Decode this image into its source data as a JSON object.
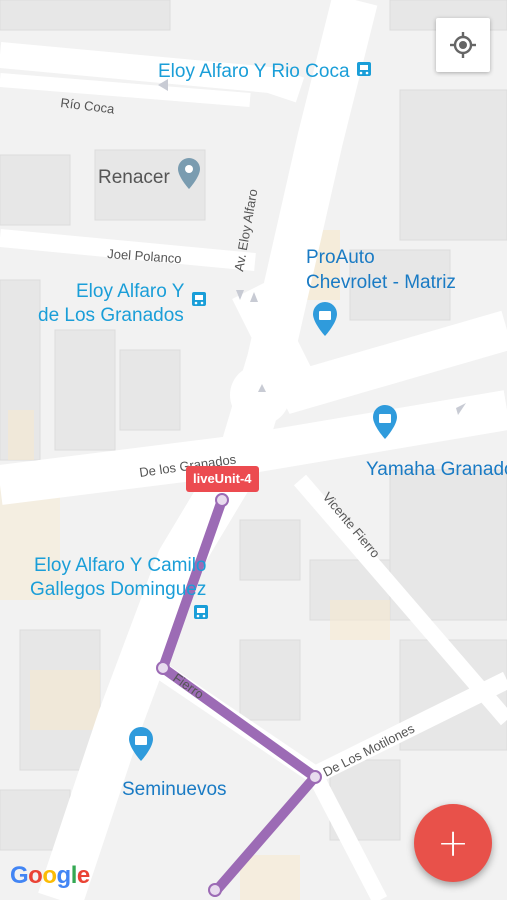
{
  "map": {
    "stops": [
      {
        "name": "Eloy Alfaro Y Rio Coca"
      },
      {
        "name_line1": "Eloy Alfaro Y",
        "name_line2": "de Los Granados"
      },
      {
        "name_line1": "Eloy Alfaro Y Camilo",
        "name_line2": "Gallegos Dominguez"
      }
    ],
    "places": [
      {
        "name": "Renacer"
      },
      {
        "name_line1": "ProAuto",
        "name_line2": "Chevrolet - Matriz"
      },
      {
        "name": "Yamaha Granados"
      },
      {
        "name": "Seminuevos"
      }
    ],
    "streets": [
      {
        "name": "Río Coca"
      },
      {
        "name": "Joel Polanco"
      },
      {
        "name": "Av. Eloy Alfaro"
      },
      {
        "name": "De los Granados"
      },
      {
        "name": "Vicente Fierro"
      },
      {
        "name": "Fierro"
      },
      {
        "name": "De Los Motilones"
      }
    ],
    "route_color": "#9c6bb5",
    "transit_color": "#1a9ed8",
    "shopping_pin_color": "#2f9bdc"
  },
  "vehicle": {
    "label": "liveUnit-4"
  },
  "controls": {
    "locate_icon": "my-location-icon",
    "fab_label": "+"
  },
  "branding": {
    "logo_text": "Google"
  }
}
